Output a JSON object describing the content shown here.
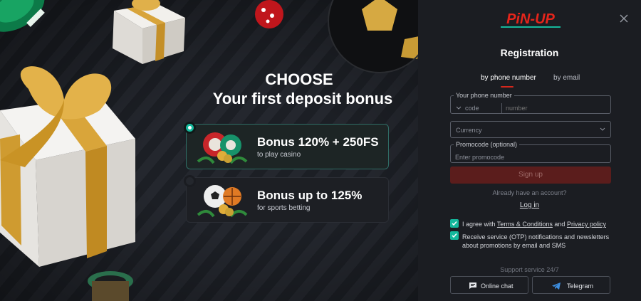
{
  "promo": {
    "title": "CHOOSE",
    "subtitle": "Your first deposit bonus",
    "bonuses": [
      {
        "title": "Bonus 120% + 250FS",
        "description": "to play casino",
        "selected": true,
        "icon": "casino-chips-icon"
      },
      {
        "title": "Bonus up to 125%",
        "description": "for sports betting",
        "selected": false,
        "icon": "sports-ball-icon"
      }
    ]
  },
  "panel": {
    "logo": "PiN-UP",
    "title": "Registration",
    "tabs": [
      {
        "label": "by phone number",
        "active": true
      },
      {
        "label": "by email",
        "active": false
      }
    ],
    "phone": {
      "legend": "Your phone number",
      "code_placeholder": "code",
      "number_placeholder": "number"
    },
    "currency": {
      "placeholder": "Currency"
    },
    "promocode": {
      "legend": "Promocode (optional)",
      "placeholder": "Enter promocode"
    },
    "signup_label": "Sign up",
    "already_text": "Already have an account?",
    "login_label": "Log in",
    "agree": {
      "prefix": "I agree with ",
      "terms": "Terms & Conditions",
      "and": " and ",
      "privacy": "Privacy policy",
      "checked": true
    },
    "notifications": {
      "text": "Receive service (OTP) notifications and newsletters about promotions by email and SMS",
      "checked": true
    },
    "support_title": "Support service 24/7",
    "chat_label": "Online chat",
    "telegram_label": "Telegram"
  },
  "colors": {
    "accent": "#d5271c",
    "teal": "#14b89c",
    "panel_bg": "#1b1d22"
  }
}
